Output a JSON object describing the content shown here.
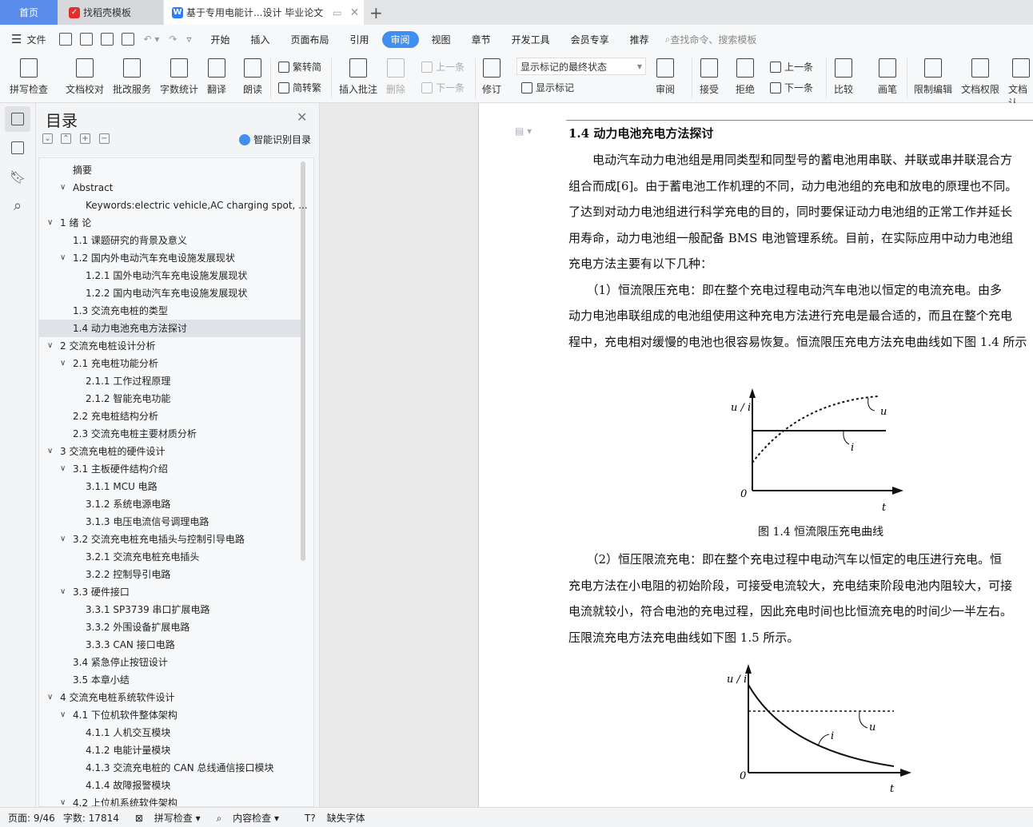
{
  "tabs": {
    "home": "首页",
    "template": "找稻壳模板",
    "document": "基于专用电能计...设计 毕业论文",
    "new_tab": "+"
  },
  "menu": {
    "file": "文件",
    "items": [
      "开始",
      "插入",
      "页面布局",
      "引用",
      "审阅",
      "视图",
      "章节",
      "开发工具",
      "会员专享",
      "推荐"
    ],
    "active": "审阅",
    "search_placeholder": "查找命令、搜索模板"
  },
  "ribbon": {
    "spell": "拼写检查",
    "proof": "文档校对",
    "correct": "批改服务",
    "wordcount": "字数统计",
    "translate": "翻译",
    "read": "朗读",
    "trad2simp": "繁转简",
    "simp2trad": "简转繁",
    "insert_comment": "插入批注",
    "delete": "删除",
    "prev_comment": "上一条",
    "next_comment": "下一条",
    "track": "修订",
    "markup_state": "显示标记的最终状态",
    "show_markup": "显示标记",
    "review": "审阅",
    "accept": "接受",
    "reject": "拒绝",
    "prev_change": "上一条",
    "next_change": "下一条",
    "compare": "比较",
    "pen": "画笔",
    "restrict": "限制编辑",
    "permission": "文档权限",
    "doc_cert": "文档认"
  },
  "toc": {
    "title": "目录",
    "smart": "智能识别目录",
    "selected_index": 14,
    "items": [
      {
        "t": "摘要",
        "lv": 1,
        "c": false
      },
      {
        "t": "Abstract",
        "lv": 1,
        "c": true
      },
      {
        "t": "Keywords:electric vehicle,AC charging spot, ...",
        "lv": 2,
        "c": false
      },
      {
        "t": "1  绪  论",
        "lv": 0,
        "c": true
      },
      {
        "t": "1.1  课题研究的背景及意义",
        "lv": 1,
        "c": false
      },
      {
        "t": "1.2  国内外电动汽车充电设施发展现状",
        "lv": 1,
        "c": true
      },
      {
        "t": "1.2.1  国外电动汽车充电设施发展现状",
        "lv": 2,
        "c": false
      },
      {
        "t": "1.2.2  国内电动汽车充电设施发展现状",
        "lv": 2,
        "c": false
      },
      {
        "t": "1.3  交流充电桩的类型",
        "lv": 1,
        "c": false
      },
      {
        "t": "1.4  动力电池充电方法探讨",
        "lv": 1,
        "c": false
      },
      {
        "t": "2  交流充电桩设计分析",
        "lv": 0,
        "c": true
      },
      {
        "t": "2.1 充电桩功能分析",
        "lv": 1,
        "c": true
      },
      {
        "t": "2.1.1  工作过程原理",
        "lv": 2,
        "c": false
      },
      {
        "t": "2.1.2  智能充电功能",
        "lv": 2,
        "c": false
      },
      {
        "t": "2.2  充电桩结构分析",
        "lv": 1,
        "c": false
      },
      {
        "t": "2.3  交流充电桩主要材质分析",
        "lv": 1,
        "c": false
      },
      {
        "t": "3  交流充电桩的硬件设计",
        "lv": 0,
        "c": true
      },
      {
        "t": "3.1  主板硬件结构介绍",
        "lv": 1,
        "c": true
      },
      {
        "t": "3.1.1 MCU 电路",
        "lv": 2,
        "c": false
      },
      {
        "t": "3.1.2  系统电源电路",
        "lv": 2,
        "c": false
      },
      {
        "t": "3.1.3 电压电流信号调理电路",
        "lv": 2,
        "c": false
      },
      {
        "t": "3.2  交流充电桩充电插头与控制引导电路",
        "lv": 1,
        "c": true
      },
      {
        "t": "3.2.1  交流充电桩充电插头",
        "lv": 2,
        "c": false
      },
      {
        "t": "3.2.2  控制导引电路",
        "lv": 2,
        "c": false
      },
      {
        "t": "3.3  硬件接口",
        "lv": 1,
        "c": true
      },
      {
        "t": "3.3.1 SP3739 串口扩展电路",
        "lv": 2,
        "c": false
      },
      {
        "t": "3.3.2  外围设备扩展电路",
        "lv": 2,
        "c": false
      },
      {
        "t": "3.3.3 CAN 接口电路",
        "lv": 2,
        "c": false
      },
      {
        "t": "3.4  紧急停止按钮设计",
        "lv": 1,
        "c": false
      },
      {
        "t": "3.5  本章小结",
        "lv": 1,
        "c": false
      },
      {
        "t": "4  交流充电桩系统软件设计",
        "lv": 0,
        "c": true
      },
      {
        "t": "4.1 下位机软件整体架构",
        "lv": 1,
        "c": true
      },
      {
        "t": "4.1.1  人机交互模块",
        "lv": 2,
        "c": false
      },
      {
        "t": "4.1.2  电能计量模块",
        "lv": 2,
        "c": false
      },
      {
        "t": "4.1.3 交流充电桩的 CAN 总线通信接口模块",
        "lv": 2,
        "c": false
      },
      {
        "t": "4.1.4 故障报警模块",
        "lv": 2,
        "c": false
      },
      {
        "t": "4.2  上位机系统软件架构",
        "lv": 1,
        "c": true
      }
    ]
  },
  "doc": {
    "heading": "1.4  动力电池充电方法探讨",
    "p1": [
      "　　电动汽车动力电池组是用同类型和同型号的蓄电池用串联、并联或串并联混合方",
      "组合而成[6]。由于蓄电池工作机理的不同，动力电池组的充电和放电的原理也不同。",
      "了达到对动力电池组进行科学充电的目的，同时要保证动力电池组的正常工作并延长",
      "用寿命，动力电池组一般配备 BMS 电池管理系统。目前，在实际应用中动力电池组",
      "充电方法主要有以下几种："
    ],
    "p2": [
      "　　（1）恒流限压充电：即在整个充电过程电动汽车电池以恒定的电流充电。由多",
      "动力电池串联组成的电池组使用这种充电方法进行充电是最合适的，而且在整个充电",
      "程中，充电相对缓慢的电池也很容易恢复。恒流限压充电方法充电曲线如下图 1.4 所示"
    ],
    "fig1": {
      "caption": "图 1.4  恒流限压充电曲线",
      "ylabel": "u / i",
      "u": "u",
      "i": "i",
      "origin": "0",
      "x": "t"
    },
    "p3": [
      "　　（2）恒压限流充电：即在整个充电过程中电动汽车以恒定的电压进行充电。恒",
      "充电方法在小电阻的初始阶段，可接受电流较大，充电结束阶段电池内阻较大，可接",
      "电流就较小，符合电池的充电过程，因此充电时间也比恒流充电的时间少一半左右。",
      "压限流充电方法充电曲线如下图 1.5 所示。"
    ],
    "fig2": {
      "ylabel": "u / i",
      "u": "u",
      "i": "i",
      "origin": "0",
      "x": "t"
    }
  },
  "status": {
    "page": "页面: 9/46",
    "words": "字数: 17814",
    "spell": "拼写检查",
    "content": "内容检查",
    "font": "缺失字体"
  }
}
